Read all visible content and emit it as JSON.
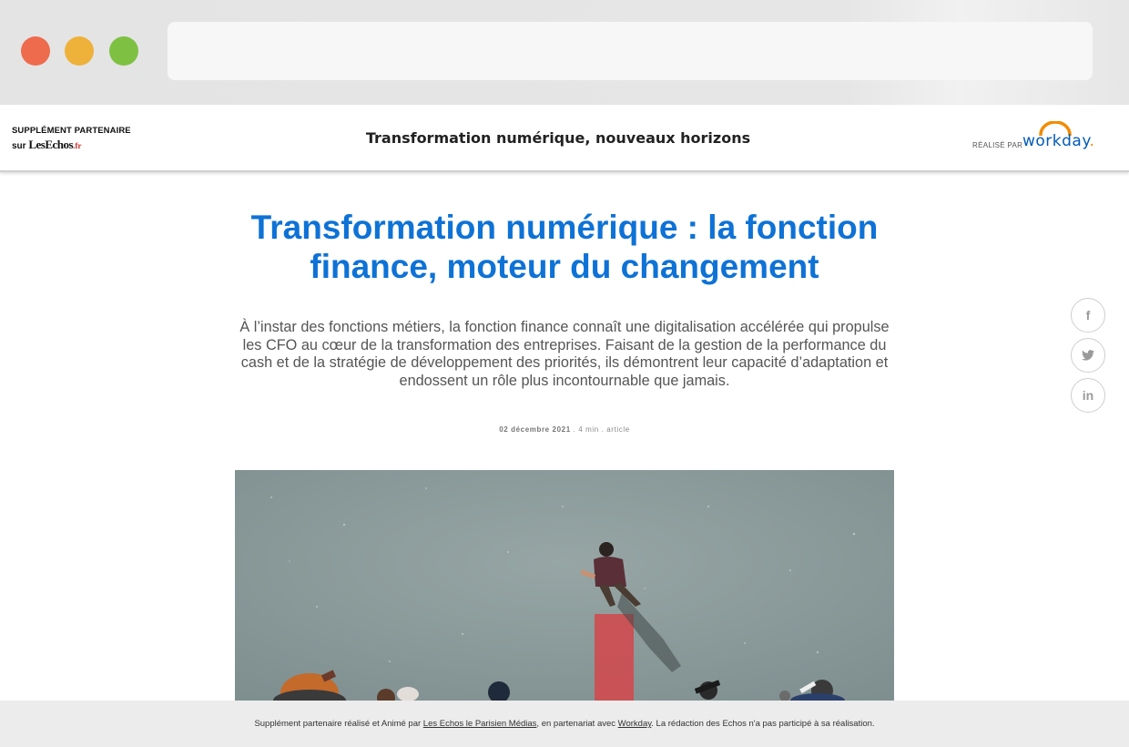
{
  "header": {
    "brand_line1": "SUPPLÉMENT PARTENAIRE",
    "brand_sur": "sur ",
    "brand_name": "LesEchos",
    "brand_tld": ".fr",
    "title": "Transformation numérique, nouveaux horizons",
    "sponsor_label": "RÉALISÉ PAR",
    "sponsor_name": "workday",
    "sponsor_dot": "."
  },
  "article": {
    "title": "Transformation numérique : la fonction finance, moteur du changement",
    "lead": "À l’instar des fonctions métiers, la fonction finance connaît une digitalisation accélérée qui propulse les CFO au cœur de la transformation des entreprises. Faisant de la gestion de la performance du cash et de la stratégie de développement des priorités, ils démontrent leur capacité d’adaptation et endossent un rôle plus incontournable que jamais.",
    "date": "02 décembre 2021",
    "separator1": " . ",
    "reading_time": "4 min",
    "separator2": " . ",
    "type": "article"
  },
  "social": {
    "facebook": "f",
    "twitter": "twitter-icon",
    "linkedin": "in"
  },
  "footer": {
    "text_before": "Supplément partenaire réalisé et Animé par ",
    "link1": "Les Echos le Parisien Médias",
    "text_middle": ", en partenariat avec ",
    "link2": "Workday",
    "text_after": ". La rédaction des Echos n'a pas participé à sa réalisation."
  },
  "colors": {
    "title_blue": "#0e72d6",
    "workday_blue": "#005cb9",
    "workday_orange": "#f38b00",
    "hero_red_bar": "#d4474a"
  }
}
